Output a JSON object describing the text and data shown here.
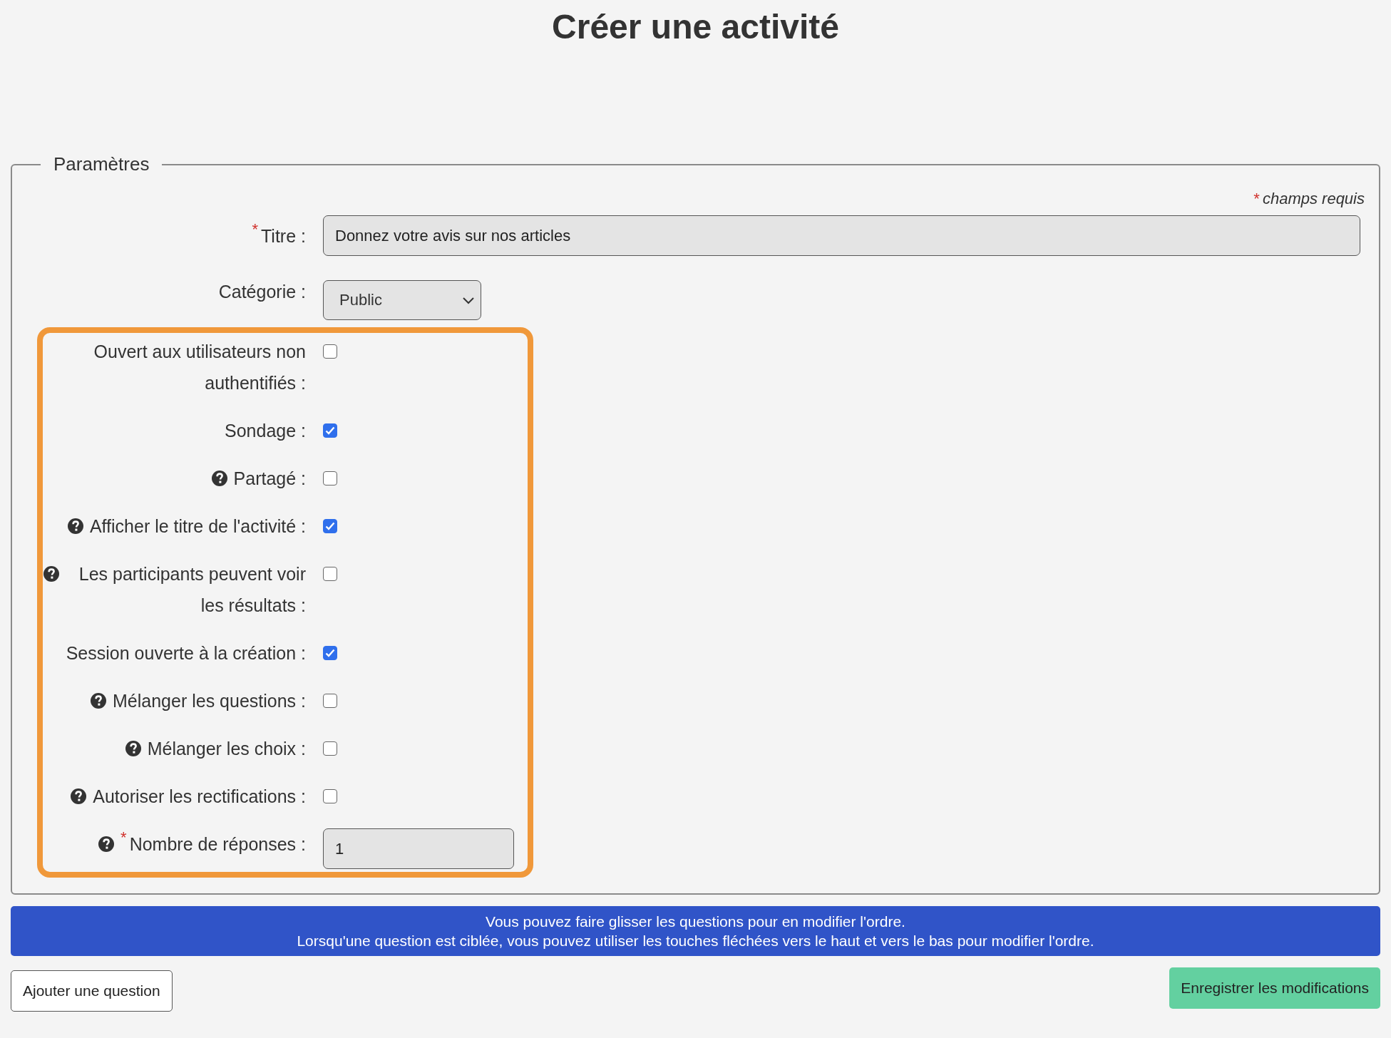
{
  "page_title": "Créer une activité",
  "fieldset": {
    "legend": "Paramètres",
    "required_note": {
      "mark": "*",
      "text": "champs requis"
    },
    "title_field": {
      "label": "Titre :",
      "required": true,
      "value": "Donnez votre avis sur nos articles"
    },
    "category_field": {
      "label": "Catégorie :",
      "value": "Public"
    },
    "options": [
      {
        "kind": "checkbox",
        "label": "Ouvert aux utilisateurs non authentifiés :",
        "help": false,
        "required": false,
        "checked": false
      },
      {
        "kind": "checkbox",
        "label": "Sondage :",
        "help": false,
        "required": false,
        "checked": true
      },
      {
        "kind": "checkbox",
        "label": "Partagé :",
        "help": true,
        "required": false,
        "checked": false
      },
      {
        "kind": "checkbox",
        "label": "Afficher le titre de l'activité :",
        "help": true,
        "required": false,
        "checked": true
      },
      {
        "kind": "checkbox",
        "label": "Les participants peuvent voir les résultats :",
        "help": true,
        "required": false,
        "checked": false
      },
      {
        "kind": "checkbox",
        "label": "Session ouverte à la création :",
        "help": false,
        "required": false,
        "checked": true
      },
      {
        "kind": "checkbox",
        "label": "Mélanger les questions :",
        "help": true,
        "required": false,
        "checked": false
      },
      {
        "kind": "checkbox",
        "label": "Mélanger les choix :",
        "help": true,
        "required": false,
        "checked": false
      },
      {
        "kind": "checkbox",
        "label": "Autoriser les rectifications :",
        "help": true,
        "required": false,
        "checked": false
      },
      {
        "kind": "number",
        "label": "Nombre de réponses :",
        "help": true,
        "required": true,
        "value": "1"
      }
    ]
  },
  "banner": [
    "Vous pouvez faire glisser les questions pour en modifier l'ordre.",
    "Lorsqu'une question est ciblée, vous pouvez utiliser les touches fléchées vers le haut et vers le bas pour modifier l'ordre."
  ],
  "buttons": {
    "add": "Ajouter une question",
    "save": "Enregistrer les modifications"
  }
}
